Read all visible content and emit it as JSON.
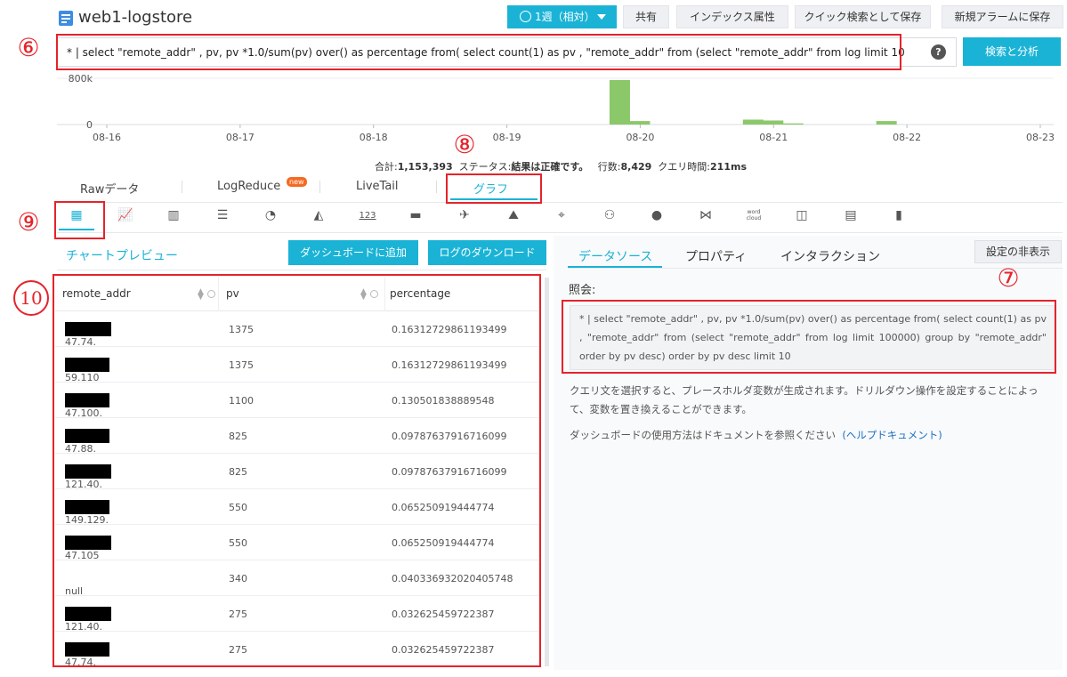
{
  "header": {
    "title": "web1-logstore",
    "time_range": "1週（相対）",
    "buttons": [
      "共有",
      "インデックス属性",
      "クイック検索として保存",
      "新規アラームに保存"
    ]
  },
  "query": {
    "text": "* | select \"remote_addr\" , pv, pv *1.0/sum(pv) over() as percentage from( select count(1) as pv , \"remote_addr\" from (select \"remote_addr\" from log limit 10",
    "help": "?",
    "search_button": "検索と分析"
  },
  "chart_data": {
    "type": "bar",
    "categories": [
      "08-16",
      "08-17",
      "08-18",
      "08-19",
      "08-20",
      "08-21",
      "08-22",
      "08-23"
    ],
    "yticks": [
      "800k",
      "0"
    ],
    "ylim": [
      0,
      800000
    ],
    "bars": [
      {
        "x": 19.85,
        "v": 770000
      },
      {
        "x": 20.0,
        "v": 60000
      },
      {
        "x": 20.85,
        "v": 85000
      },
      {
        "x": 21.0,
        "v": 70000
      },
      {
        "x": 21.15,
        "v": 20000
      },
      {
        "x": 21.85,
        "v": 60000
      }
    ],
    "color": "#8bc86a"
  },
  "status": {
    "total_label": "合計:",
    "total": "1,153,393",
    "status_label": "ステータス:",
    "status": "結果は正確です。",
    "rows_label": "行数:",
    "rows": "8,429",
    "time_label": "クエリ時間:",
    "time": "211ms"
  },
  "tabs": {
    "raw": "Rawデータ",
    "logreduce": "LogReduce",
    "new_badge": "new",
    "livetail": "LiveTail",
    "graph": "グラフ"
  },
  "chart_icons": [
    "table-icon",
    "line-chart-icon",
    "bar-chart-icon",
    "horizontal-bar-icon",
    "pie-chart-icon",
    "area-chart-icon",
    "number-icon",
    "progress-icon",
    "world-map-icon",
    "china-map-icon",
    "geo-map-icon",
    "flow-icon",
    "bubble-icon",
    "sankey-icon",
    "word-cloud-icon",
    "treemap-icon",
    "column-icon",
    "stacked-icon"
  ],
  "number_icon_text": "123",
  "wordcloud_icon_text": "word cloud",
  "preview": {
    "title": "チャートプレビュー",
    "add_dashboard": "ダッシュボードに追加",
    "download": "ログのダウンロード"
  },
  "table": {
    "columns": [
      "remote_addr",
      "pv",
      "percentage"
    ],
    "rows": [
      [
        "47.74.",
        "1375",
        "0.16312729861193499"
      ],
      [
        "59.110",
        "1375",
        "0.16312729861193499"
      ],
      [
        "47.100.",
        "1100",
        "0.130501838889548"
      ],
      [
        "47.88.",
        "825",
        "0.09787637916716099"
      ],
      [
        "121.40.",
        "825",
        "0.09787637916716099"
      ],
      [
        "149.129.",
        "550",
        "0.065250919444774"
      ],
      [
        "47.105",
        "550",
        "0.065250919444774"
      ],
      [
        "null",
        "340",
        "0.040336932020405748"
      ],
      [
        "121.40.",
        "275",
        "0.032625459722387"
      ],
      [
        "47.74.",
        "275",
        "0.032625459722387"
      ]
    ]
  },
  "settings": {
    "tabs": [
      "データソース",
      "プロパティ",
      "インタラクション"
    ],
    "hide": "設定の非表示",
    "query_label": "照会:",
    "query_text": "* | select \"remote_addr\" , pv, pv *1.0/sum(pv) over() as percentage from( select count(1) as pv , \"remote_addr\" from (select \"remote_addr\" from log limit 100000) group by \"remote_addr\" order by pv desc) order by pv desc limit 10",
    "desc": "クエリ文を選択すると、プレースホルダ変数が生成されます。ドリルダウン操作を設定することによって、変数を置き換えることができます。",
    "doc_text": "ダッシュボードの使用方法はドキュメントを参照ください",
    "doc_link": "(ヘルプドキュメント)"
  },
  "annotations": {
    "a6": "⑥",
    "a7": "⑦",
    "a8": "⑧",
    "a9": "⑨",
    "a10": "10"
  }
}
